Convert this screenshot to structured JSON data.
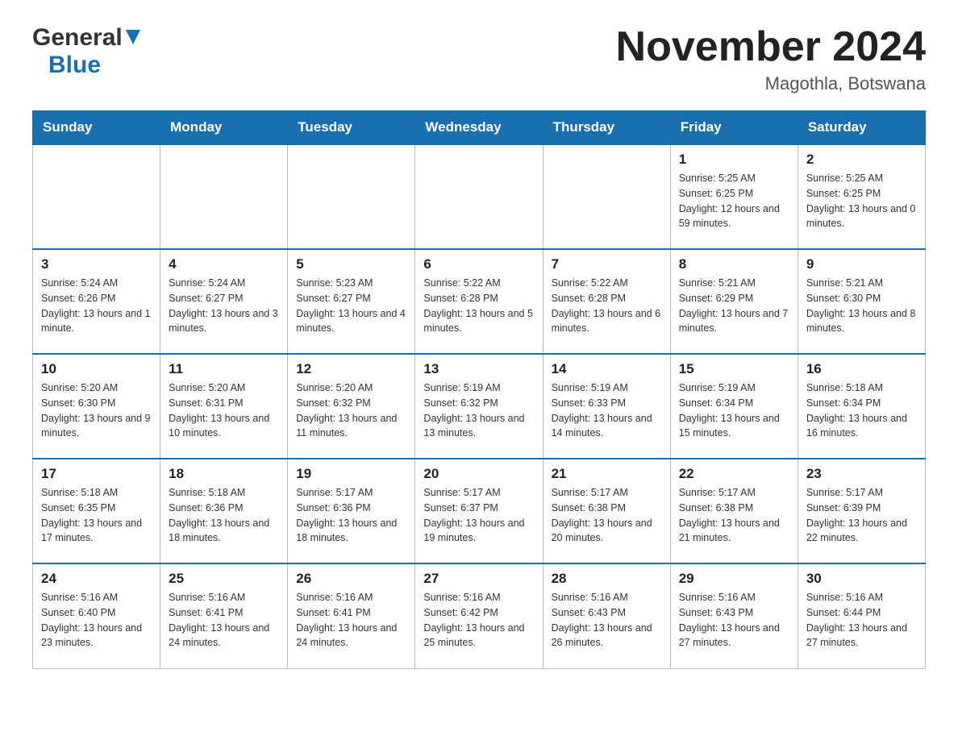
{
  "header": {
    "logo_general": "General",
    "logo_blue": "Blue",
    "title": "November 2024",
    "subtitle": "Magothla, Botswana"
  },
  "days_of_week": [
    "Sunday",
    "Monday",
    "Tuesday",
    "Wednesday",
    "Thursday",
    "Friday",
    "Saturday"
  ],
  "weeks": [
    {
      "days": [
        {
          "num": "",
          "info": ""
        },
        {
          "num": "",
          "info": ""
        },
        {
          "num": "",
          "info": ""
        },
        {
          "num": "",
          "info": ""
        },
        {
          "num": "",
          "info": ""
        },
        {
          "num": "1",
          "info": "Sunrise: 5:25 AM\nSunset: 6:25 PM\nDaylight: 12 hours\nand 59 minutes."
        },
        {
          "num": "2",
          "info": "Sunrise: 5:25 AM\nSunset: 6:25 PM\nDaylight: 13 hours\nand 0 minutes."
        }
      ]
    },
    {
      "days": [
        {
          "num": "3",
          "info": "Sunrise: 5:24 AM\nSunset: 6:26 PM\nDaylight: 13 hours\nand 1 minute."
        },
        {
          "num": "4",
          "info": "Sunrise: 5:24 AM\nSunset: 6:27 PM\nDaylight: 13 hours\nand 3 minutes."
        },
        {
          "num": "5",
          "info": "Sunrise: 5:23 AM\nSunset: 6:27 PM\nDaylight: 13 hours\nand 4 minutes."
        },
        {
          "num": "6",
          "info": "Sunrise: 5:22 AM\nSunset: 6:28 PM\nDaylight: 13 hours\nand 5 minutes."
        },
        {
          "num": "7",
          "info": "Sunrise: 5:22 AM\nSunset: 6:28 PM\nDaylight: 13 hours\nand 6 minutes."
        },
        {
          "num": "8",
          "info": "Sunrise: 5:21 AM\nSunset: 6:29 PM\nDaylight: 13 hours\nand 7 minutes."
        },
        {
          "num": "9",
          "info": "Sunrise: 5:21 AM\nSunset: 6:30 PM\nDaylight: 13 hours\nand 8 minutes."
        }
      ]
    },
    {
      "days": [
        {
          "num": "10",
          "info": "Sunrise: 5:20 AM\nSunset: 6:30 PM\nDaylight: 13 hours\nand 9 minutes."
        },
        {
          "num": "11",
          "info": "Sunrise: 5:20 AM\nSunset: 6:31 PM\nDaylight: 13 hours\nand 10 minutes."
        },
        {
          "num": "12",
          "info": "Sunrise: 5:20 AM\nSunset: 6:32 PM\nDaylight: 13 hours\nand 11 minutes."
        },
        {
          "num": "13",
          "info": "Sunrise: 5:19 AM\nSunset: 6:32 PM\nDaylight: 13 hours\nand 13 minutes."
        },
        {
          "num": "14",
          "info": "Sunrise: 5:19 AM\nSunset: 6:33 PM\nDaylight: 13 hours\nand 14 minutes."
        },
        {
          "num": "15",
          "info": "Sunrise: 5:19 AM\nSunset: 6:34 PM\nDaylight: 13 hours\nand 15 minutes."
        },
        {
          "num": "16",
          "info": "Sunrise: 5:18 AM\nSunset: 6:34 PM\nDaylight: 13 hours\nand 16 minutes."
        }
      ]
    },
    {
      "days": [
        {
          "num": "17",
          "info": "Sunrise: 5:18 AM\nSunset: 6:35 PM\nDaylight: 13 hours\nand 17 minutes."
        },
        {
          "num": "18",
          "info": "Sunrise: 5:18 AM\nSunset: 6:36 PM\nDaylight: 13 hours\nand 18 minutes."
        },
        {
          "num": "19",
          "info": "Sunrise: 5:17 AM\nSunset: 6:36 PM\nDaylight: 13 hours\nand 18 minutes."
        },
        {
          "num": "20",
          "info": "Sunrise: 5:17 AM\nSunset: 6:37 PM\nDaylight: 13 hours\nand 19 minutes."
        },
        {
          "num": "21",
          "info": "Sunrise: 5:17 AM\nSunset: 6:38 PM\nDaylight: 13 hours\nand 20 minutes."
        },
        {
          "num": "22",
          "info": "Sunrise: 5:17 AM\nSunset: 6:38 PM\nDaylight: 13 hours\nand 21 minutes."
        },
        {
          "num": "23",
          "info": "Sunrise: 5:17 AM\nSunset: 6:39 PM\nDaylight: 13 hours\nand 22 minutes."
        }
      ]
    },
    {
      "days": [
        {
          "num": "24",
          "info": "Sunrise: 5:16 AM\nSunset: 6:40 PM\nDaylight: 13 hours\nand 23 minutes."
        },
        {
          "num": "25",
          "info": "Sunrise: 5:16 AM\nSunset: 6:41 PM\nDaylight: 13 hours\nand 24 minutes."
        },
        {
          "num": "26",
          "info": "Sunrise: 5:16 AM\nSunset: 6:41 PM\nDaylight: 13 hours\nand 24 minutes."
        },
        {
          "num": "27",
          "info": "Sunrise: 5:16 AM\nSunset: 6:42 PM\nDaylight: 13 hours\nand 25 minutes."
        },
        {
          "num": "28",
          "info": "Sunrise: 5:16 AM\nSunset: 6:43 PM\nDaylight: 13 hours\nand 26 minutes."
        },
        {
          "num": "29",
          "info": "Sunrise: 5:16 AM\nSunset: 6:43 PM\nDaylight: 13 hours\nand 27 minutes."
        },
        {
          "num": "30",
          "info": "Sunrise: 5:16 AM\nSunset: 6:44 PM\nDaylight: 13 hours\nand 27 minutes."
        }
      ]
    }
  ]
}
